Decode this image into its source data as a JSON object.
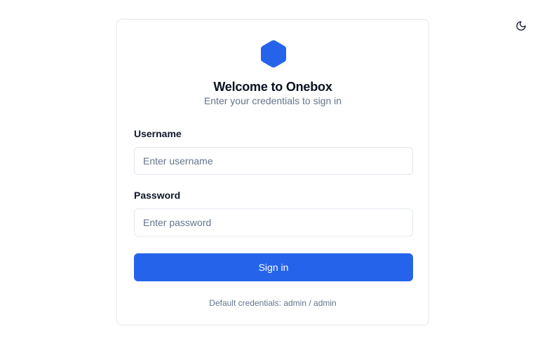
{
  "theme_toggle": {
    "icon": "moon-icon"
  },
  "card": {
    "logo_icon": "hexagon-logo-icon",
    "title": "Welcome to Onebox",
    "subtitle": "Enter your credentials to sign in"
  },
  "form": {
    "username": {
      "label": "Username",
      "placeholder": "Enter username",
      "value": ""
    },
    "password": {
      "label": "Password",
      "placeholder": "Enter password",
      "value": ""
    },
    "submit_label": "Sign in"
  },
  "footer": {
    "hint": "Default credentials: admin / admin"
  },
  "colors": {
    "accent": "#2563eb",
    "muted_text": "#64748b",
    "border": "#e2e8f0"
  }
}
